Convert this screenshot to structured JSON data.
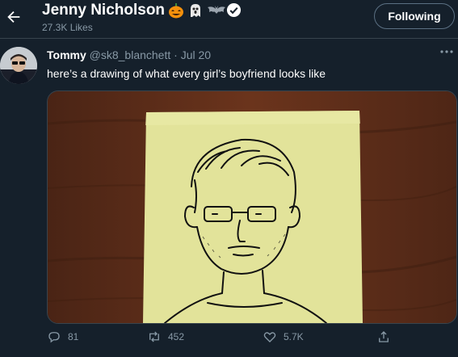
{
  "header": {
    "title": "Jenny Nicholson",
    "subtitle": "27.3K Likes",
    "follow_label": "Following",
    "back_icon": "back-arrow-icon",
    "emojis": [
      "pumpkin-emoji-icon",
      "ghost-emoji-icon",
      "bat-emoji-icon"
    ],
    "verified_icon": "verified-badge-icon"
  },
  "tweet": {
    "author": "Tommy",
    "handle": "@sk8_blanchett",
    "separator": "·",
    "date": "Jul 20",
    "text": "here’s a drawing of what every girl’s boyfriend looks like",
    "actions": {
      "reply_count": "81",
      "retweet_count": "452",
      "like_count": "5.7K"
    }
  },
  "colors": {
    "background": "#15202b",
    "border": "#38444d",
    "muted_text": "#8899a6",
    "text": "#ffffff",
    "sticky_note": "#e2e39a",
    "wood": "#5a2c18"
  }
}
